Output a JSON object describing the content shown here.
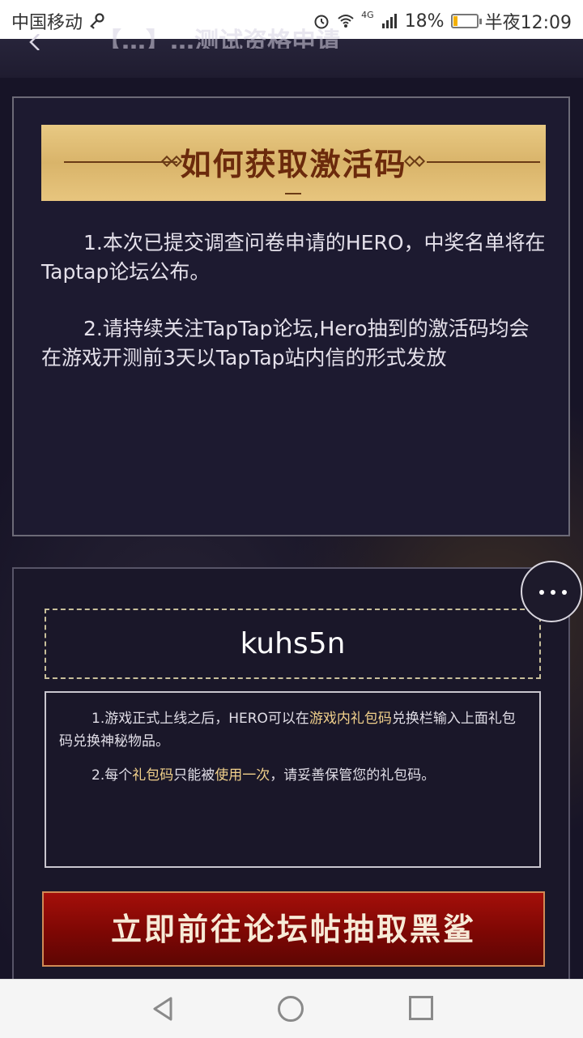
{
  "status_bar": {
    "carrier": "中国移动",
    "network": "4G",
    "battery_pct": "18%",
    "battery_level": 0.18,
    "time": "半夜12:09"
  },
  "header": {
    "title": "【…】…测试资格申请"
  },
  "activation_section": {
    "banner_title": "如何获取激活码",
    "paragraph1": "1.本次已提交调查问卷申请的HERO，中奖名单将在Taptap论坛公布。",
    "paragraph2": "2.请持续关注TapTap论坛,Hero抽到的激活码均会在游戏开测前3天以TapTap站内信的形式发放"
  },
  "gift_section": {
    "code": "kuhs5n",
    "note1_a": "1.游戏正式上线之后，HERO可以在",
    "note1_hl": "游戏内礼包码",
    "note1_b": "兑换栏输入上面礼包码兑换神秘物品。",
    "note2_a": "2.每个",
    "note2_hl1": "礼包码",
    "note2_b": "只能被",
    "note2_hl2": "使用一次",
    "note2_c": "，请妥善保管您的礼包码。",
    "button_label": "立即前往论坛帖抽取黑鲨"
  },
  "colors": {
    "accent_gold": "#e3c07a",
    "button_red": "#8e0b06",
    "highlight": "#f1d08b"
  }
}
